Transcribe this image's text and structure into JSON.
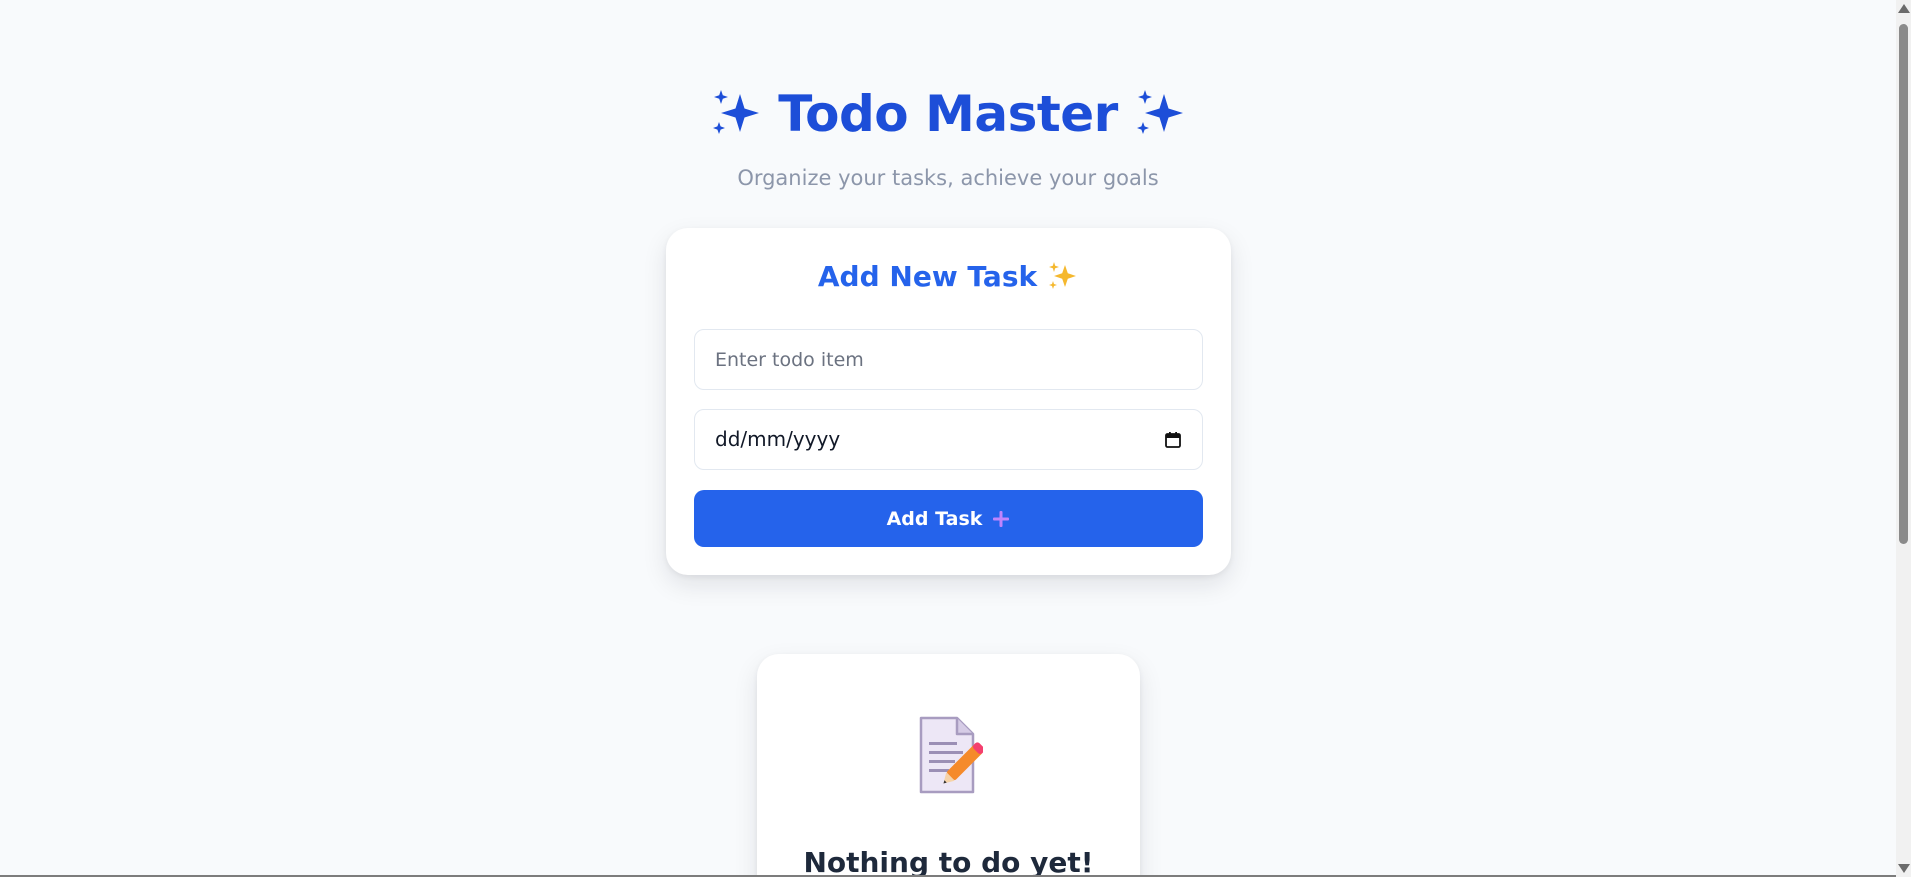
{
  "header": {
    "title": "Todo Master",
    "subtitle": "Organize your tasks, achieve your goals",
    "left_icon": "sparkles-icon",
    "right_icon": "sparkles-icon"
  },
  "add_task": {
    "heading": "Add New Task",
    "heading_icon": "sparkles-icon",
    "todo_placeholder": "Enter todo item",
    "todo_value": "",
    "date_placeholder": "dd/mm/yyyy",
    "date_icon": "calendar-icon",
    "button_label": "Add Task",
    "button_icon": "plus-icon"
  },
  "empty_state": {
    "icon": "memo-pencil-icon",
    "title": "Nothing to do yet!"
  },
  "colors": {
    "background": "#f8fafc",
    "title": "#1d4ed8",
    "accent": "#2563eb",
    "subtitle": "#8c96aa",
    "sparkle_yellow": "#f5b82e",
    "plus_pink": "#c084fc"
  }
}
